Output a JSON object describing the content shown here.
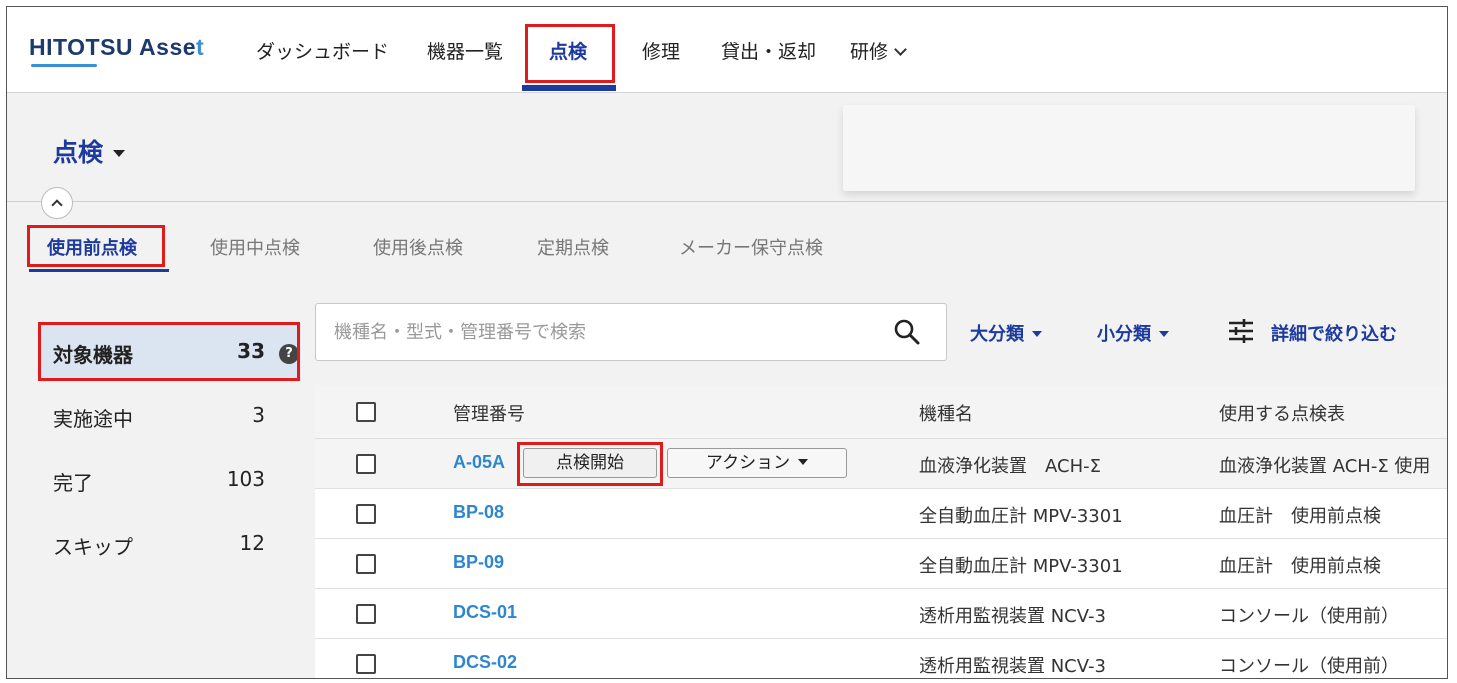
{
  "app": {
    "logo_main": "HITOTSU Asse",
    "logo_accent": "t"
  },
  "nav": {
    "items": [
      {
        "label": "ダッシュボード"
      },
      {
        "label": "機器一覧"
      },
      {
        "label": "点検",
        "active": true
      },
      {
        "label": "修理"
      },
      {
        "label": "貸出・返却"
      },
      {
        "label": "研修"
      }
    ]
  },
  "page": {
    "title": "点検"
  },
  "subtabs": [
    {
      "label": "使用前点検",
      "active": true
    },
    {
      "label": "使用中点検"
    },
    {
      "label": "使用後点検"
    },
    {
      "label": "定期点検"
    },
    {
      "label": "メーカー保守点検"
    }
  ],
  "status_list": [
    {
      "label": "対象機器",
      "count": "33",
      "selected": true
    },
    {
      "label": "実施途中",
      "count": "3"
    },
    {
      "label": "完了",
      "count": "103"
    },
    {
      "label": "スキップ",
      "count": "12"
    }
  ],
  "search": {
    "placeholder": "機種名・型式・管理番号で検索",
    "value": ""
  },
  "filters": {
    "major_category": "大分類",
    "minor_category": "小分類",
    "advanced": "詳細で絞り込む"
  },
  "table": {
    "headers": [
      "管理番号",
      "機種名",
      "使用する点検表"
    ],
    "rows": [
      {
        "code": "A-05A",
        "model": "血液浄化装置　ACH-Σ",
        "checklist": "血液浄化装置 ACH-Σ 使用",
        "start_label": "点検開始",
        "action_label": "アクション"
      },
      {
        "code": "BP-08",
        "model": "全自動血圧計 MPV-3301",
        "checklist": "血圧計　使用前点検"
      },
      {
        "code": "BP-09",
        "model": "全自動血圧計 MPV-3301",
        "checklist": "血圧計　使用前点検"
      },
      {
        "code": "DCS-01",
        "model": "透析用監視装置 NCV-3",
        "checklist": "コンソール（使用前）"
      },
      {
        "code": "DCS-02",
        "model": "透析用監視装置 NCV-3",
        "checklist": "コンソール（使用前）"
      }
    ]
  },
  "colors": {
    "brand": "#1d3a9e",
    "link": "#2f86d0",
    "highlight": "#e01b1b",
    "selected_bg": "#dbe5f2"
  },
  "help_icon_glyph": "?"
}
